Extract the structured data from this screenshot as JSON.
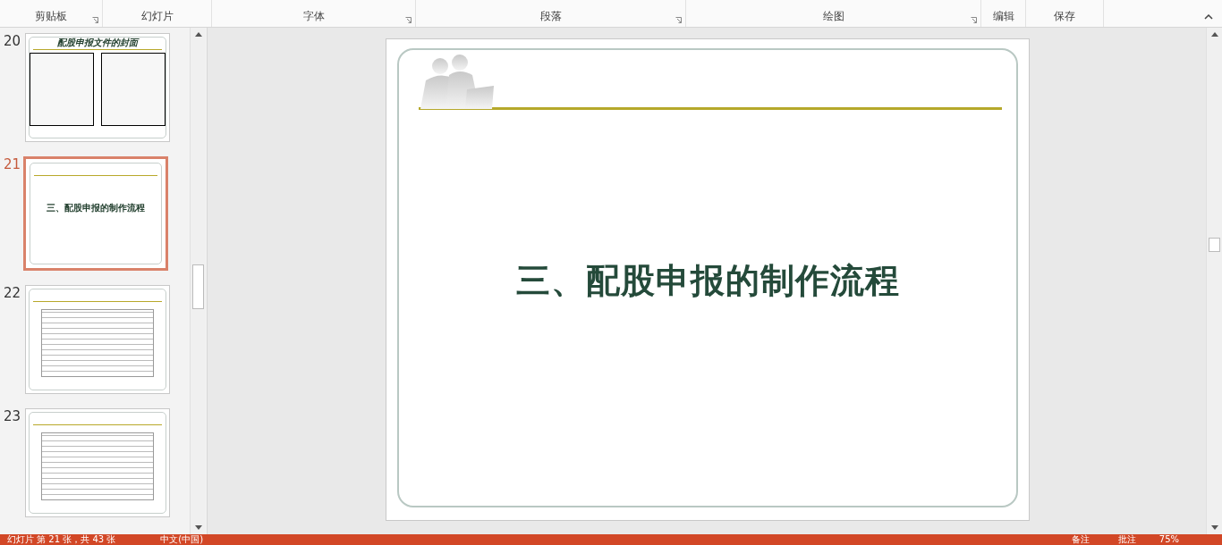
{
  "ribbon": {
    "groups": [
      {
        "label": "剪贴板",
        "launcher": true
      },
      {
        "label": "幻灯片",
        "launcher": false
      },
      {
        "label": "字体",
        "launcher": true
      },
      {
        "label": "段落",
        "launcher": true
      },
      {
        "label": "绘图",
        "launcher": true
      },
      {
        "label": "编辑",
        "launcher": false
      },
      {
        "label": "保存",
        "launcher": false
      }
    ]
  },
  "thumbnails": [
    {
      "number": "20",
      "kind": "covers",
      "title": "配股申报文件的封面",
      "selected": false
    },
    {
      "number": "21",
      "kind": "title",
      "title": "三、配股申报的制作流程",
      "selected": true
    },
    {
      "number": "22",
      "kind": "document",
      "selected": false
    },
    {
      "number": "23",
      "kind": "document",
      "selected": false
    }
  ],
  "slide": {
    "title": "三、配股申报的制作流程"
  },
  "status_bar": {
    "slide_info": "幻灯片 第 21 张，共 43 张",
    "language": "中文(中国)",
    "notes": "备注",
    "comments": "批注",
    "zoom": "75%"
  }
}
